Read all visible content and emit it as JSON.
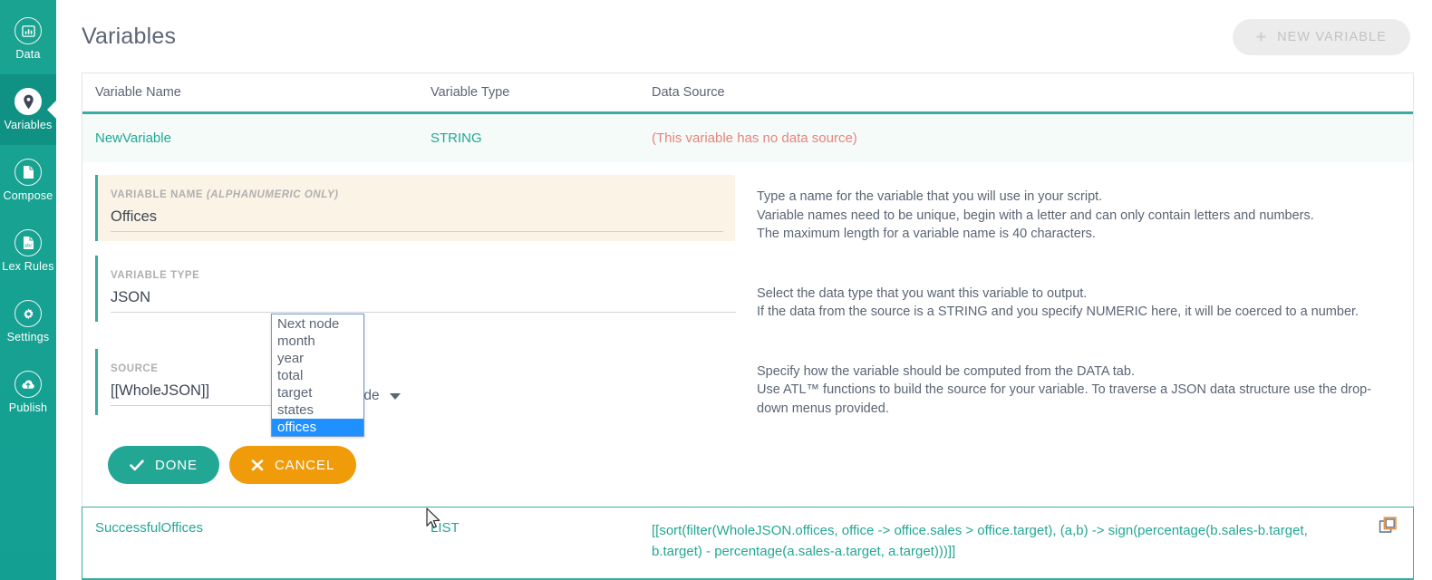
{
  "sidebar": {
    "items": [
      {
        "label": "Data",
        "icon": "chart-bar-icon",
        "active": false
      },
      {
        "label": "Variables",
        "icon": "map-pin-icon",
        "active": true
      },
      {
        "label": "Compose",
        "icon": "document-icon",
        "active": false
      },
      {
        "label": "Lex Rules",
        "icon": "document-code-icon",
        "active": false
      },
      {
        "label": "Settings",
        "icon": "gear-icon",
        "active": false
      },
      {
        "label": "Publish",
        "icon": "cloud-upload-icon",
        "active": false
      }
    ]
  },
  "header": {
    "title": "Variables",
    "new_variable_label": "NEW VARIABLE",
    "new_variable_plus": "+"
  },
  "table": {
    "columns": [
      "Variable Name",
      "Variable Type",
      "Data Source"
    ],
    "selected_row": {
      "name": "NewVariable",
      "type": "STRING",
      "source": "(This variable has no data source)"
    },
    "last_row": {
      "name": "SuccessfulOffices",
      "type": "LIST",
      "source": "[[sort(filter(WholeJSON.offices, office -> office.sales > office.target), (a,b) -> sign(percentage(b.sales-b.target, b.target) - percentage(a.sales-a.target, a.target)))]]"
    }
  },
  "editor": {
    "name_field": {
      "label_main": "VARIABLE NAME ",
      "label_em": "(ALPHANUMERIC ONLY)",
      "value": "Offices"
    },
    "type_field": {
      "label": "VARIABLE TYPE",
      "value": "JSON"
    },
    "source_field": {
      "label": "SOURCE",
      "value": "[[WholeJSON]]",
      "node_select_value": "Next node",
      "node_options": [
        "Next node",
        "month",
        "year",
        "total",
        "target",
        "states",
        "offices"
      ],
      "node_selected": "offices"
    },
    "buttons": {
      "done": "DONE",
      "cancel": "CANCEL"
    },
    "help": [
      "Type a name for the variable that you will use in your script.\nVariable names need to be unique, begin with a letter and can only contain letters and numbers.\nThe maximum length for a variable name is 40 characters.",
      "Select the data type that you want this variable to output.\nIf the data from the source is a STRING and you specify NUMERIC here, it will be coerced to a number.",
      "Specify how the variable should be computed from the DATA tab.\nUse ATL™ functions to build the source for your variable. To traverse a JSON data structure use the drop-down menus provided."
    ]
  },
  "colors": {
    "sidebar_teal": "#13a092",
    "sidebar_active": "#0f9184",
    "accent_teal": "#23a795",
    "accent_orange": "#ef9b0a",
    "row_highlight": "#f4fbf9",
    "field_highlight": "#fbf3e6",
    "error_red": "#e8837e",
    "select_blue": "#1e90ff",
    "text_gray": "#5b6575"
  }
}
